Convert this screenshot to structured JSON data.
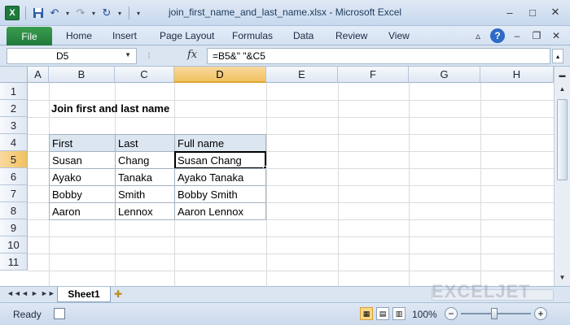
{
  "window": {
    "title": "join_first_name_and_last_name.xlsx - Microsoft Excel",
    "app_icon": "X",
    "controls": [
      "–",
      "□",
      "✕"
    ]
  },
  "ribbon": {
    "file_tab": "File",
    "tabs": [
      "Home",
      "Insert",
      "Page Layout",
      "Formulas",
      "Data",
      "Review",
      "View"
    ],
    "help": "?"
  },
  "formula_bar": {
    "name_box": "D5",
    "fx": "fx",
    "formula": "=B5&\" \"&C5"
  },
  "grid": {
    "columns": [
      "A",
      "B",
      "C",
      "D",
      "E",
      "F",
      "G",
      "H"
    ],
    "active_column": "D",
    "rows": [
      "1",
      "2",
      "3",
      "4",
      "5",
      "6",
      "7",
      "8",
      "9",
      "10",
      "11"
    ],
    "active_row": "5",
    "heading": "Join first and last name",
    "table": {
      "headers": [
        "First",
        "Last",
        "Full name"
      ],
      "rows": [
        [
          "Susan",
          "Chang",
          "Susan Chang"
        ],
        [
          "Ayako",
          "Tanaka",
          "Ayako Tanaka"
        ],
        [
          "Bobby",
          "Smith",
          "Bobby Smith"
        ],
        [
          "Aaron",
          "Lennox",
          "Aaron Lennox"
        ]
      ]
    },
    "selected_cell": "D5"
  },
  "sheets": {
    "active": "Sheet1",
    "nav": [
      "◄◄",
      "◄",
      "►",
      "►►"
    ]
  },
  "watermark": "EXCELJET",
  "status": {
    "mode": "Ready",
    "zoom": "100%",
    "zoom_minus": "−",
    "zoom_plus": "+"
  },
  "icons": {
    "save": "save-icon",
    "undo": "undo-icon",
    "redo": "redo-icon",
    "refresh": "refresh-icon"
  }
}
